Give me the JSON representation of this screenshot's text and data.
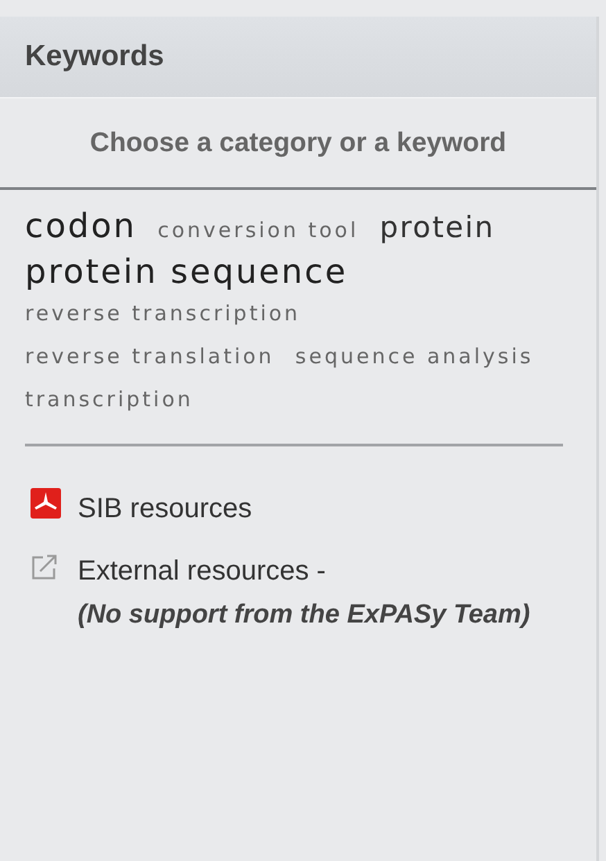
{
  "panel": {
    "title": "Keywords",
    "subtitle": "Choose a category or a keyword"
  },
  "keywords": [
    {
      "label": "codon",
      "kind": "large"
    },
    {
      "label": "conversion tool",
      "kind": "small"
    },
    {
      "label": "protein",
      "kind": "medium"
    },
    {
      "label": "protein sequence",
      "kind": "large"
    },
    {
      "label": "reverse transcription",
      "kind": "small"
    },
    {
      "label": "reverse translation",
      "kind": "small"
    },
    {
      "label": "sequence analysis",
      "kind": "small"
    },
    {
      "label": "transcription",
      "kind": "small"
    }
  ],
  "resources": [
    {
      "kind": "sib",
      "label": "SIB resources"
    },
    {
      "kind": "external",
      "label": "External resources -",
      "note": "(No support from the ExPASy Team)"
    }
  ]
}
